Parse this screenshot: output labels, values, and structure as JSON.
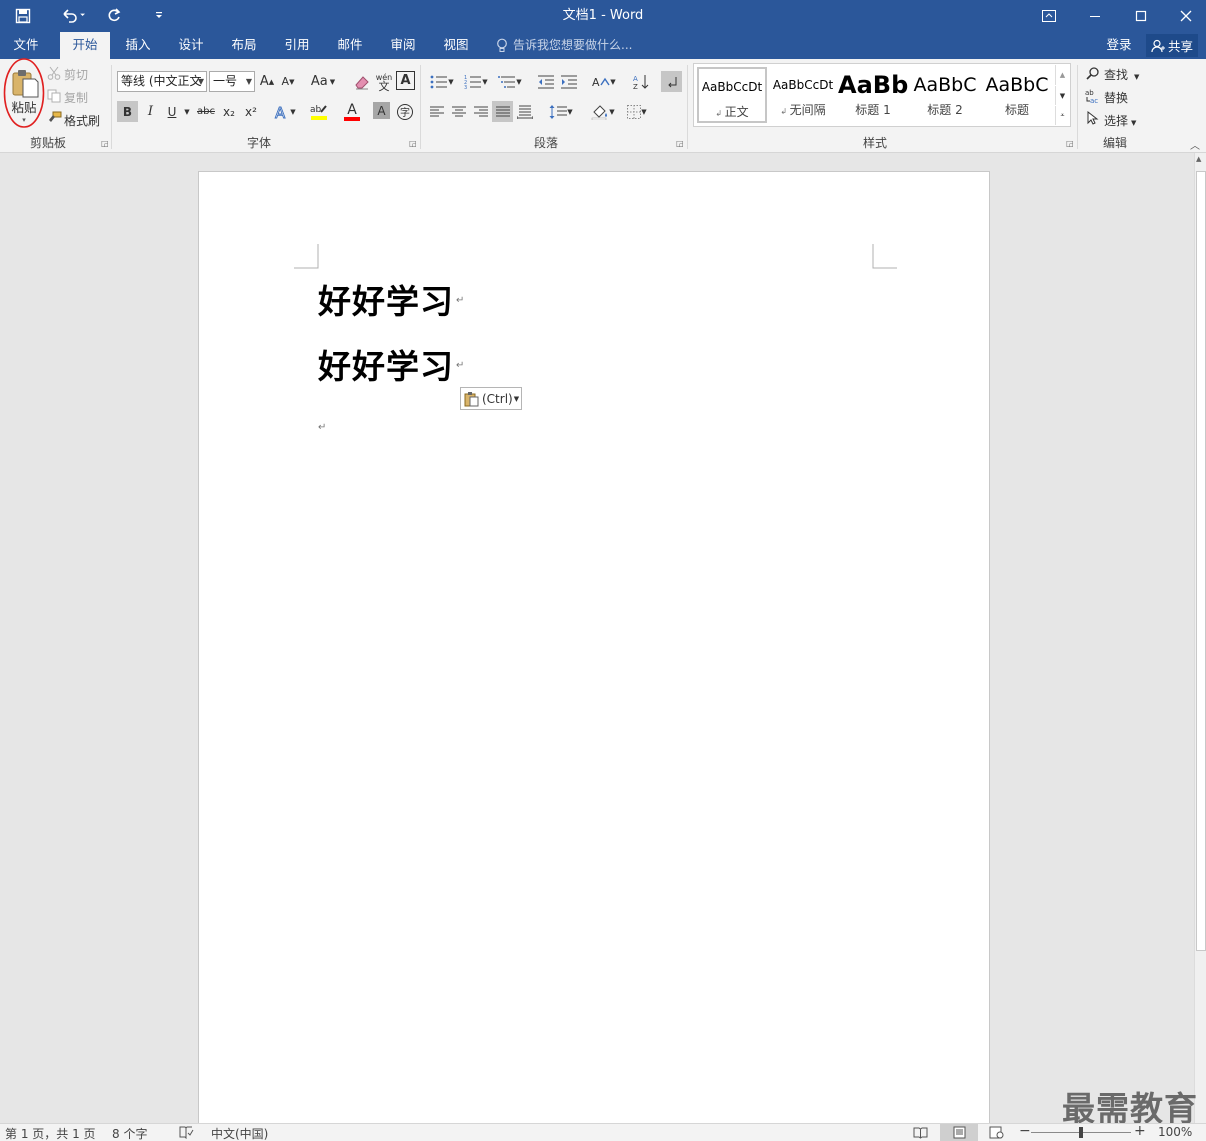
{
  "window": {
    "title": "文档1 - Word"
  },
  "quick_access": {
    "save_icon": "save-icon",
    "undo_icon": "undo-icon",
    "redo_icon": "redo-icon",
    "customize_icon": "customize-qat-icon"
  },
  "tabs": [
    {
      "label": "文件"
    },
    {
      "label": "开始"
    },
    {
      "label": "插入"
    },
    {
      "label": "设计"
    },
    {
      "label": "布局"
    },
    {
      "label": "引用"
    },
    {
      "label": "邮件"
    },
    {
      "label": "审阅"
    },
    {
      "label": "视图"
    }
  ],
  "tellme": {
    "placeholder": "告诉我您想要做什么..."
  },
  "account": {
    "signin": "登录",
    "share": "共享"
  },
  "clipboard": {
    "paste": "粘贴",
    "cut": "剪切",
    "copy": "复制",
    "format_painter": "格式刷",
    "group": "剪贴板"
  },
  "font": {
    "name": "等线 (中文正文",
    "size": "一号",
    "grow": "A",
    "shrink": "A",
    "case": "Aa",
    "bold": "B",
    "italic": "I",
    "underline": "U",
    "strike": "abc",
    "sub": "x₂",
    "sup": "x²",
    "group": "字体"
  },
  "paragraph": {
    "group": "段落"
  },
  "styles": {
    "items": [
      {
        "preview": "AaBbCcDt",
        "name": "正文"
      },
      {
        "preview": "AaBbCcDt",
        "name": "无间隔"
      },
      {
        "preview": "AaBb",
        "name": "标题 1"
      },
      {
        "preview": "AaBbC",
        "name": "标题 2"
      },
      {
        "preview": "AaBbC",
        "name": "标题"
      }
    ],
    "group": "样式"
  },
  "editing": {
    "find": "查找",
    "replace": "替换",
    "select": "选择",
    "group": "编辑"
  },
  "document": {
    "line1": "好好学习",
    "line2": "好好学习",
    "paste_options": "(Ctrl)"
  },
  "status": {
    "page": "第 1 页，共 1 页",
    "words": "8 个字",
    "language": "中文(中国)",
    "zoom": "100%"
  },
  "watermark": "最需教育",
  "colors": {
    "accent": "#2b579a",
    "highlight": "#ffff00",
    "font_color": "#ff0000",
    "annotation": "#e02020"
  }
}
